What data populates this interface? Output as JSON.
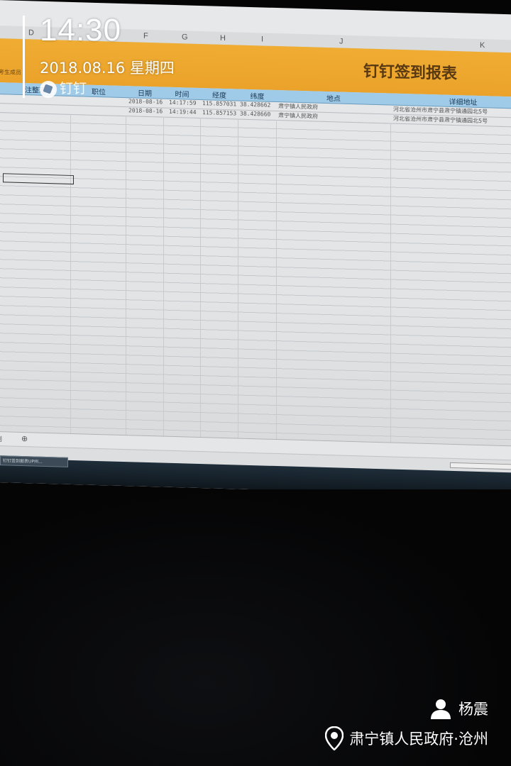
{
  "spreadsheet": {
    "column_letters": [
      "D",
      "F",
      "G",
      "H",
      "I",
      "J",
      "K"
    ],
    "report_title": "钉钉签到报表",
    "band_note": "考生成员",
    "headers": [
      "注整理",
      "职位",
      "日期",
      "时间",
      "经度",
      "纬度",
      "地点",
      "详细地址"
    ],
    "rows": [
      {
        "date": "2018-08-16",
        "time": "14:17:59",
        "longitude": "115.857031",
        "latitude": "38.428662",
        "place": "肃宁镇人民政府",
        "address": "河北省沧州市肃宁县肃宁镇通园北5号"
      },
      {
        "date": "2018-08-16",
        "time": "14:19:44",
        "longitude": "115.857153",
        "latitude": "38.428660",
        "place": "肃宁镇人民政府",
        "address": "河北省沧州市肃宁县肃宁镇通园北5号"
      }
    ],
    "sheet_tab": "到",
    "add_sheet": "⊕",
    "taskbar_item": "钉钉签到报表UP州..."
  },
  "watermark": {
    "time": "14:30",
    "date": "2018.08.16 星期四",
    "brand": "钉钉",
    "user_icon": "person-icon",
    "user": "杨震",
    "location_icon": "map-pin-icon",
    "location": "肃宁镇人民政府·沧州"
  }
}
